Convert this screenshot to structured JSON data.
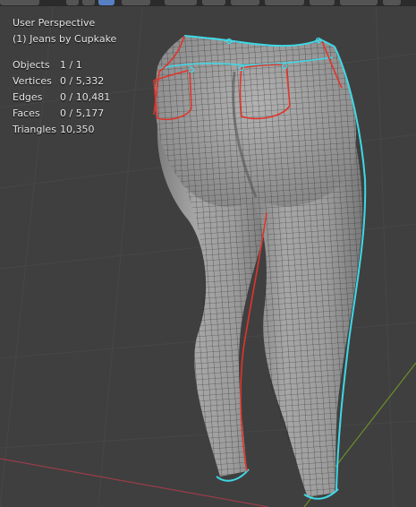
{
  "viewport": {
    "view_name": "User Perspective",
    "object_name": "(1) Jeans by Cupkake"
  },
  "stats": [
    {
      "label": "Objects",
      "value": "1 / 1"
    },
    {
      "label": "Vertices",
      "value": "0 / 5,332"
    },
    {
      "label": "Edges",
      "value": "0 / 10,481"
    },
    {
      "label": "Faces",
      "value": "0 / 5,177"
    },
    {
      "label": "Triangles",
      "value": "10,350"
    }
  ],
  "colors": {
    "background": "#3f3f3f",
    "grid": "#4a4a4a",
    "x_axis": "#9a3d4a",
    "y_axis": "#6b8f2a",
    "mesh_fill": "#9a9a9a",
    "wire": "#1e1e1e",
    "seam": "#e0352b",
    "boundary": "#3fd8e6",
    "text": "#e6e6e6"
  }
}
